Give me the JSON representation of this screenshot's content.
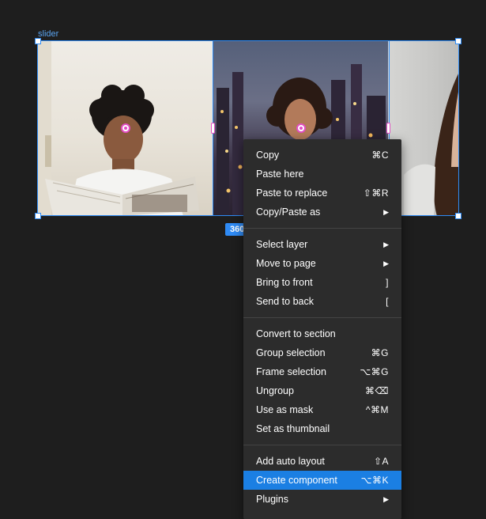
{
  "canvas": {
    "frame_label": "slider",
    "dimension_badge": "360"
  },
  "context_menu": {
    "groups": [
      [
        {
          "label": "Copy",
          "shortcut": "⌘C"
        },
        {
          "label": "Paste here",
          "shortcut": ""
        },
        {
          "label": "Paste to replace",
          "shortcut": "⇧⌘R"
        },
        {
          "label": "Copy/Paste as",
          "submenu": true
        }
      ],
      [
        {
          "label": "Select layer",
          "submenu": true
        },
        {
          "label": "Move to page",
          "submenu": true
        },
        {
          "label": "Bring to front",
          "shortcut": "]"
        },
        {
          "label": "Send to back",
          "shortcut": "["
        }
      ],
      [
        {
          "label": "Convert to section",
          "shortcut": ""
        },
        {
          "label": "Group selection",
          "shortcut": "⌘G"
        },
        {
          "label": "Frame selection",
          "shortcut": "⌥⌘G"
        },
        {
          "label": "Ungroup",
          "shortcut": "⌘⌫"
        },
        {
          "label": "Use as mask",
          "shortcut": "^⌘M"
        },
        {
          "label": "Set as thumbnail",
          "shortcut": ""
        }
      ],
      [
        {
          "label": "Add auto layout",
          "shortcut": "⇧A"
        },
        {
          "label": "Create component",
          "shortcut": "⌥⌘K",
          "highlighted": true
        },
        {
          "label": "Plugins",
          "submenu": true
        }
      ]
    ],
    "submenu_arrow": "▶",
    "highlight_color": "#1b7fe3"
  },
  "colors": {
    "selection": "#2f8bf5",
    "handle_accent": "#e34ec4",
    "canvas_background": "#1e1e1e"
  }
}
